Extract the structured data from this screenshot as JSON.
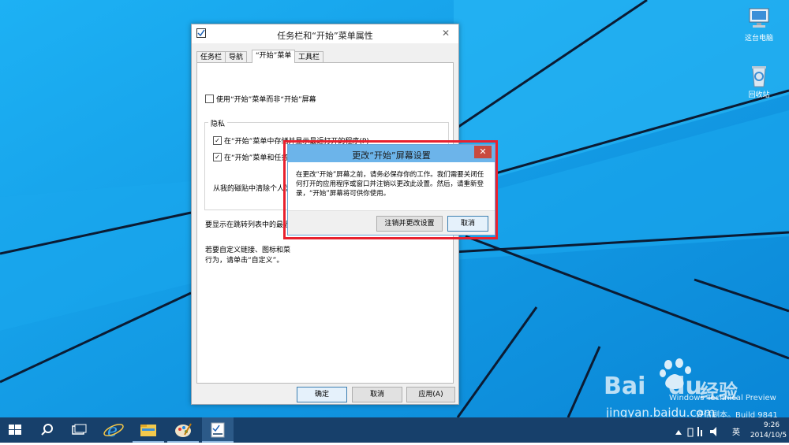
{
  "desktop": {
    "icons": [
      {
        "label": "这台电脑",
        "icon": "computer-icon"
      },
      {
        "label": "回收站",
        "icon": "recycle-bin-icon"
      }
    ]
  },
  "main_window": {
    "title": "任务栏和“开始”菜单属性",
    "tabs": [
      "任务栏",
      "导航",
      "“开始”菜单",
      "工具栏"
    ],
    "active_tab": "“开始”菜单",
    "use_start_menu_checkbox": {
      "label": "使用“开始”菜单而非“开始”屏幕",
      "checked": false
    },
    "privacy_group": {
      "title": "隐私",
      "checkbox_1": {
        "label": "在“开始”菜单中存储并显示最近打开的程序(P)",
        "checked": true
      },
      "checkbox_2": {
        "label": "在“开始”菜单和任务栏中存储并显示最近打开的项目(M)",
        "checked": true
      },
      "remove_text": "从我的磁贴中清除个人信"
    },
    "jumplist_text": "要显示在跳转列表中的最近",
    "customize_text_1": "若要自定义链接、图标和菜",
    "customize_text_2": "行为，请单击“自定义”。",
    "buttons": {
      "ok": "确定",
      "cancel": "取消",
      "apply": "应用(A)"
    }
  },
  "dialog": {
    "title": "更改“开始”屏幕设置",
    "message": "在更改“开始”屏幕之前，请务必保存你的工作。我们需要关闭任何打开的应用程序或窗口并注销以更改此设置。然后，请重新登录，“开始”屏幕将可供你使用。",
    "buttons": {
      "signout": "注销并更改设置",
      "cancel": "取消"
    }
  },
  "watermark": {
    "line1": "Windows Technical Preview",
    "line2": "评估副本。Build 9841",
    "baidu": "Bai",
    "baidu2": "du",
    "jingyan": "经验",
    "url": "jingyan.baidu.com"
  },
  "taskbar": {
    "items": [
      {
        "name": "start",
        "icon": "windows-logo-icon"
      },
      {
        "name": "search",
        "icon": "search-icon"
      },
      {
        "name": "task-view",
        "icon": "task-view-icon"
      },
      {
        "name": "ie",
        "icon": "internet-explorer-icon"
      },
      {
        "name": "explorer",
        "icon": "file-explorer-icon"
      },
      {
        "name": "paint",
        "icon": "paint-icon"
      },
      {
        "name": "properties",
        "icon": "taskbar-properties-icon"
      }
    ],
    "tray": {
      "ime": "英",
      "time": "9:26",
      "date": "2014/10/5"
    }
  },
  "colors": {
    "desktop": "#0f9be8",
    "taskbar": "#17406b",
    "highlight": "#e8212f",
    "dialog_title": "#6cb4ea"
  }
}
